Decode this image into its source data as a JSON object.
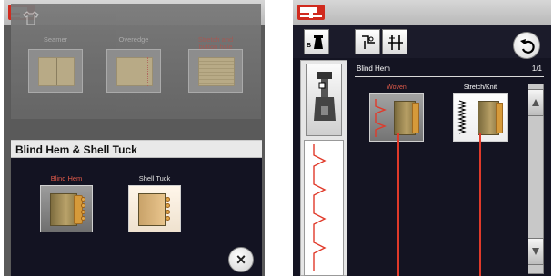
{
  "left": {
    "categories": [
      {
        "label": "Seamer",
        "color": "gray"
      },
      {
        "label": "Overedge",
        "color": "gray"
      },
      {
        "label": "Stretch and\nbutton hole",
        "color": "red"
      }
    ],
    "section_title": "Blind Hem & Shell Tuck",
    "stitches": [
      {
        "label": "Blind Hem",
        "color": "red"
      },
      {
        "label": "Shell Tuck",
        "color": "white"
      }
    ],
    "close_label": "×"
  },
  "right": {
    "presser_foot_label": "B",
    "list_title": "Blind Hem",
    "page_indicator": "1/1",
    "options": [
      {
        "label": "Woven",
        "color": "red"
      },
      {
        "label": "Stretch/Knit",
        "color": "white"
      }
    ]
  },
  "colors": {
    "accent_red": "#e03a2a",
    "dark_panel": "#131322",
    "header_bar": "#e9e9e9"
  }
}
